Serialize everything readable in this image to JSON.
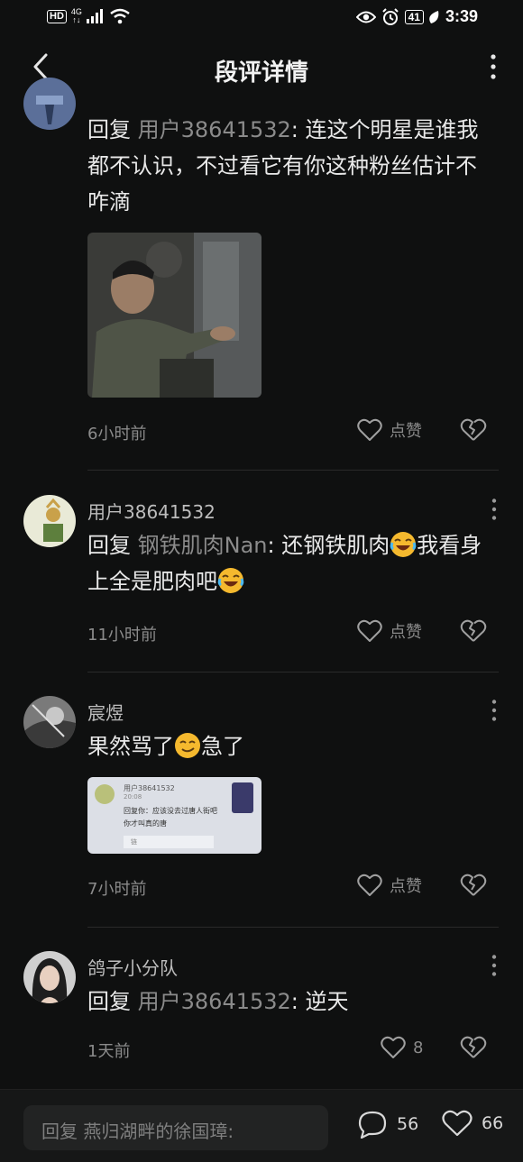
{
  "status_bar": {
    "hd": "HD",
    "network": "4G",
    "battery": "41",
    "time": "3:39"
  },
  "header": {
    "title": "段评详情"
  },
  "comments": [
    {
      "reply_keyword": "回复",
      "reply_target": "用户38641532",
      "text": ": 连这个明星是谁我都不认识，不过看它有你这种粉丝估计不咋滴",
      "time": "6小时前",
      "like_label": "点赞"
    },
    {
      "username": "用户38641532",
      "reply_keyword": "回复",
      "reply_target": "钢铁肌肉Nan",
      "text_a": ": 还钢铁肌肉",
      "text_b": "我看身上全是肥肉吧",
      "time": "11小时前",
      "like_label": "点赞"
    },
    {
      "username": "宸煜",
      "text_a": "果然骂了",
      "text_b": "急了",
      "time": "7小时前",
      "like_label": "点赞",
      "image": {
        "username": "用户38641532",
        "time": "20:08",
        "line1": "回复你：应该没去过唐人街吧",
        "line2": "你才叫真的唐",
        "chip": "链"
      }
    },
    {
      "username": "鸽子小分队",
      "reply_keyword": "回复",
      "reply_target": "用户38641532",
      "text": ": 逆天",
      "time": "1天前",
      "like_count": "8"
    }
  ],
  "bottom_bar": {
    "input_placeholder": "回复 燕归湖畔的徐国璋:",
    "comment_count": "56",
    "like_count": "66"
  }
}
